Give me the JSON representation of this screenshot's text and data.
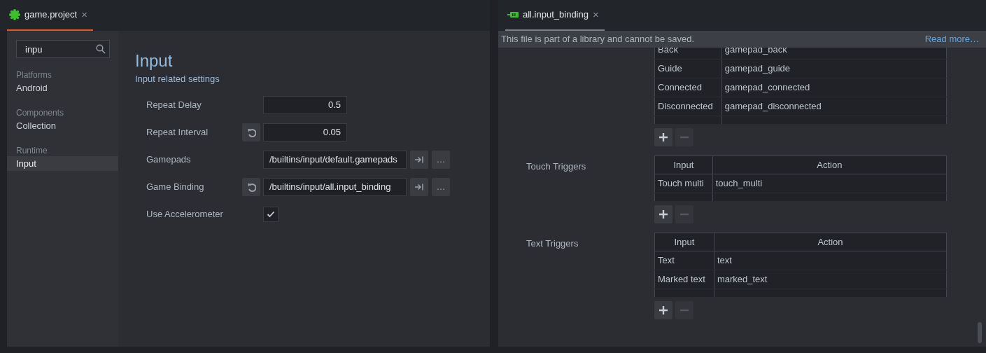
{
  "left_pane": {
    "tab": {
      "label": "game.project",
      "close": "×",
      "focused": true
    },
    "search": {
      "value": "inpu"
    },
    "sidebar": [
      {
        "category": "Platforms",
        "items": [
          {
            "label": "Android",
            "selected": false
          }
        ]
      },
      {
        "category": "Components",
        "items": [
          {
            "label": "Collection",
            "selected": false
          }
        ]
      },
      {
        "category": "Runtime",
        "items": [
          {
            "label": "Input",
            "selected": true
          }
        ]
      }
    ],
    "heading": "Input",
    "subheading": "Input related settings",
    "fields": [
      {
        "kind": "number",
        "label": "Repeat Delay",
        "value": "0.5",
        "overridden": false
      },
      {
        "kind": "number",
        "label": "Repeat Interval",
        "value": "0.05",
        "overridden": true
      },
      {
        "kind": "resource",
        "label": "Gamepads",
        "value": "/builtins/input/default.gamepads",
        "overridden": false,
        "more": "…"
      },
      {
        "kind": "resource",
        "label": "Game Binding",
        "value": "/builtins/input/all.input_binding",
        "overridden": true,
        "more": "…"
      },
      {
        "kind": "checkbox",
        "label": "Use Accelerometer",
        "checked": true,
        "overridden": false
      }
    ]
  },
  "right_pane": {
    "tab": {
      "label": "all.input_binding",
      "close": "×",
      "focused": false
    },
    "banner": {
      "message": "This file is part of a library and cannot be saved.",
      "link": "Read more…"
    },
    "sections": [
      {
        "rows": [
          {
            "input": "Back",
            "action": "gamepad_back"
          },
          {
            "input": "Guide",
            "action": "gamepad_guide"
          },
          {
            "input": "Connected",
            "action": "gamepad_connected"
          },
          {
            "input": "Disconnected",
            "action": "gamepad_disconnected"
          }
        ],
        "remove_disabled": true
      },
      {
        "title": "Touch Triggers",
        "columns": [
          "Input",
          "Action"
        ],
        "rows": [
          {
            "input": "Touch multi",
            "action": "touch_multi"
          }
        ],
        "remove_disabled": true
      },
      {
        "title": "Text Triggers",
        "columns": [
          "Input",
          "Action"
        ],
        "rows": [
          {
            "input": "Text",
            "action": "text"
          },
          {
            "input": "Marked text",
            "action": "marked_text"
          }
        ],
        "remove_disabled": true
      }
    ]
  }
}
